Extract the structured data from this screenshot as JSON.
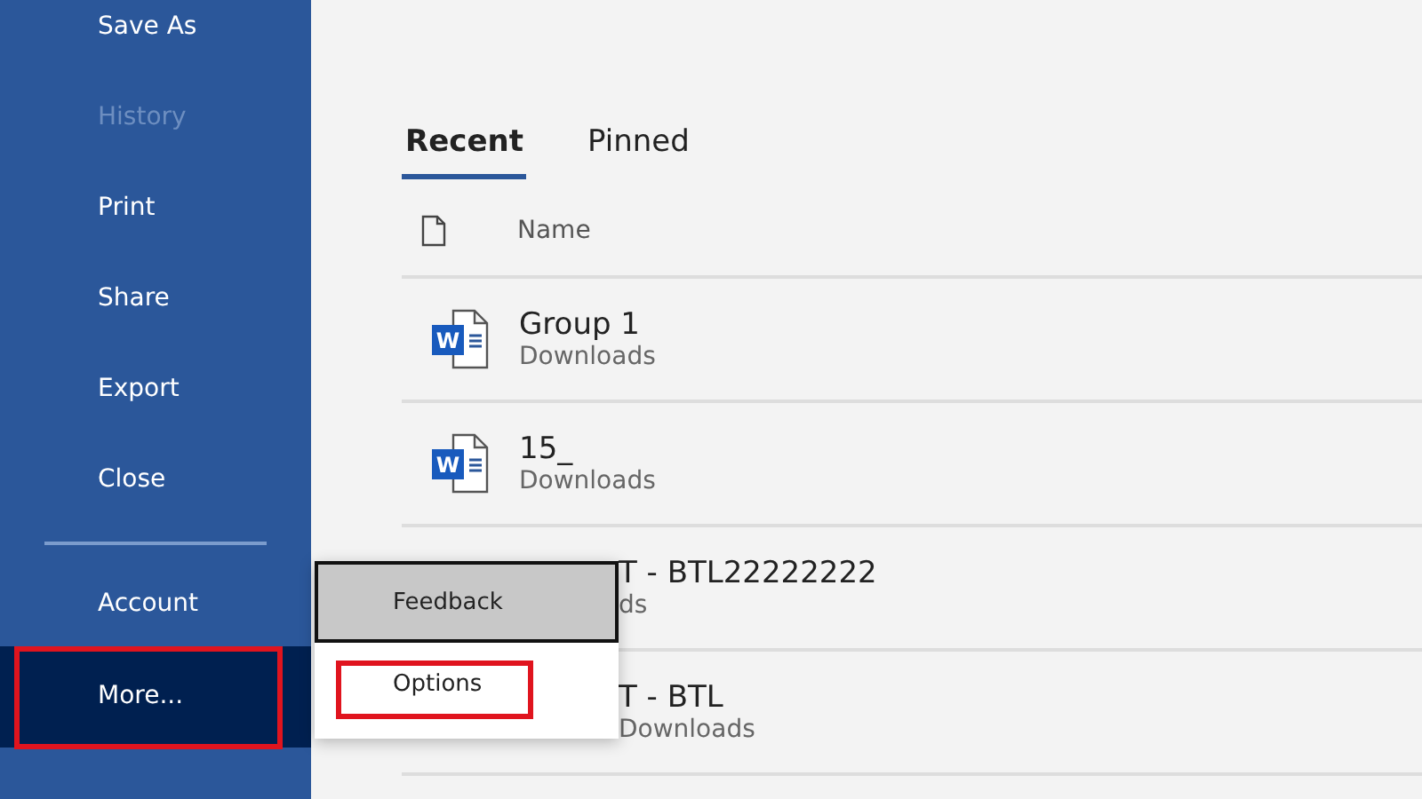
{
  "sidebar": {
    "items": [
      {
        "kind": "item",
        "label": "Save As",
        "disabled": false,
        "selected": false
      },
      {
        "kind": "item",
        "label": "History",
        "disabled": true,
        "selected": false
      },
      {
        "kind": "item",
        "label": "Print",
        "disabled": false,
        "selected": false
      },
      {
        "kind": "item",
        "label": "Share",
        "disabled": false,
        "selected": false
      },
      {
        "kind": "item",
        "label": "Export",
        "disabled": false,
        "selected": false
      },
      {
        "kind": "item",
        "label": "Close",
        "disabled": false,
        "selected": false
      },
      {
        "kind": "divider"
      },
      {
        "kind": "item",
        "label": "Account",
        "disabled": false,
        "selected": false
      },
      {
        "kind": "item",
        "label": "More...",
        "disabled": false,
        "selected": true,
        "highlighted": true
      }
    ]
  },
  "tabs": [
    {
      "label": "Recent",
      "selected": true
    },
    {
      "label": "Pinned",
      "selected": false
    }
  ],
  "table": {
    "columns": [
      "Name"
    ],
    "rows": [
      {
        "name": "Group 1",
        "location": "Downloads",
        "badge": "W",
        "covered": false
      },
      {
        "name": "15_",
        "location": "Downloads",
        "badge": "W",
        "covered": false
      },
      {
        "name": "T - BTL22222222",
        "location": "ds",
        "covered": true
      },
      {
        "name": "T - BTL",
        "location": "Downloads",
        "covered": true
      }
    ]
  },
  "popup_menu": {
    "items": [
      {
        "label": "Feedback",
        "hovered": true,
        "highlighted": false
      },
      {
        "label": "Options",
        "hovered": false,
        "highlighted": true
      }
    ]
  }
}
